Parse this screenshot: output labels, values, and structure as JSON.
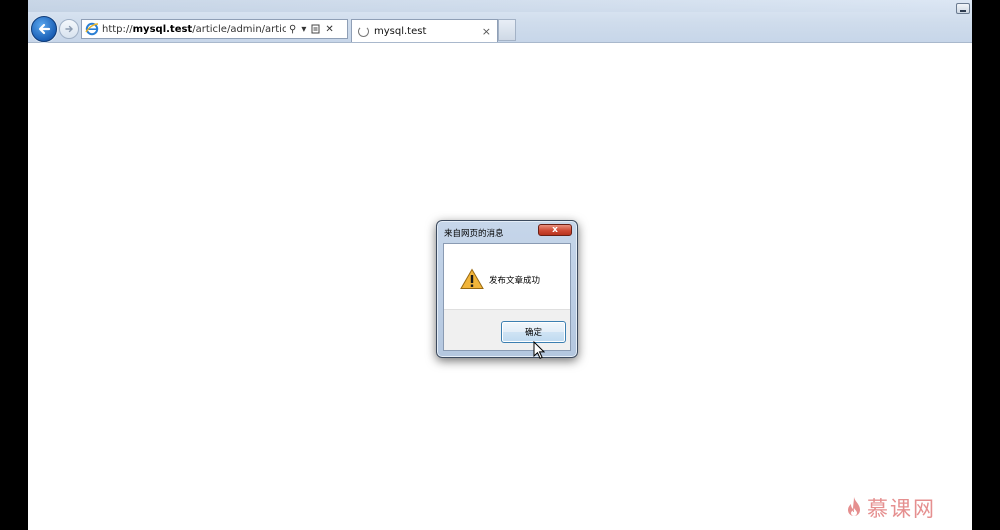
{
  "browser": {
    "url_prefix": "http://",
    "url_host": "mysql.test",
    "url_path": "/article/admin/article.add.hanc",
    "tab_title": "mysql.test",
    "tab_close": "×",
    "search_glyph": "⚲",
    "dropdown_glyph": "▾",
    "stop_glyph": "✕"
  },
  "dialog": {
    "title": "来自网页的消息",
    "close_label": "x",
    "message": "发布文章成功",
    "ok_label": "确定"
  },
  "watermark": {
    "text": "慕课网"
  },
  "colors": {
    "back_button": "#1a5fb6",
    "dialog_close": "#cf4a35",
    "watermark": "#e58f8f"
  }
}
